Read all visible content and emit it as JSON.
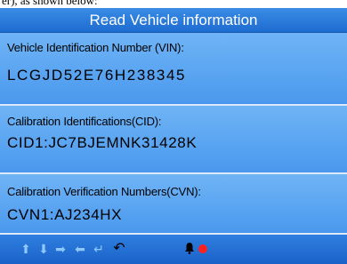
{
  "top_strip_text": "er), as shown below:",
  "header": {
    "title": "Read Vehicle information"
  },
  "vin": {
    "label": "Vehicle Identification Number (VIN):",
    "value": "LCGJD52E76H238345"
  },
  "cid": {
    "label": "Calibration Identifications(CID):",
    "value": "CID1:JC7BJEMNK31428K"
  },
  "cvn": {
    "label": "Calibration Verification Numbers(CVN):",
    "value": "CVN1:AJ234HX"
  },
  "toolbar": {
    "icons": [
      "arrow-up-icon",
      "arrow-down-icon",
      "arrow-right-icon",
      "arrow-left-icon",
      "enter-icon",
      "back-icon",
      "bell-icon",
      "record-icon"
    ],
    "accent_color": "#2f7fe0",
    "record_color": "#ff2020"
  }
}
